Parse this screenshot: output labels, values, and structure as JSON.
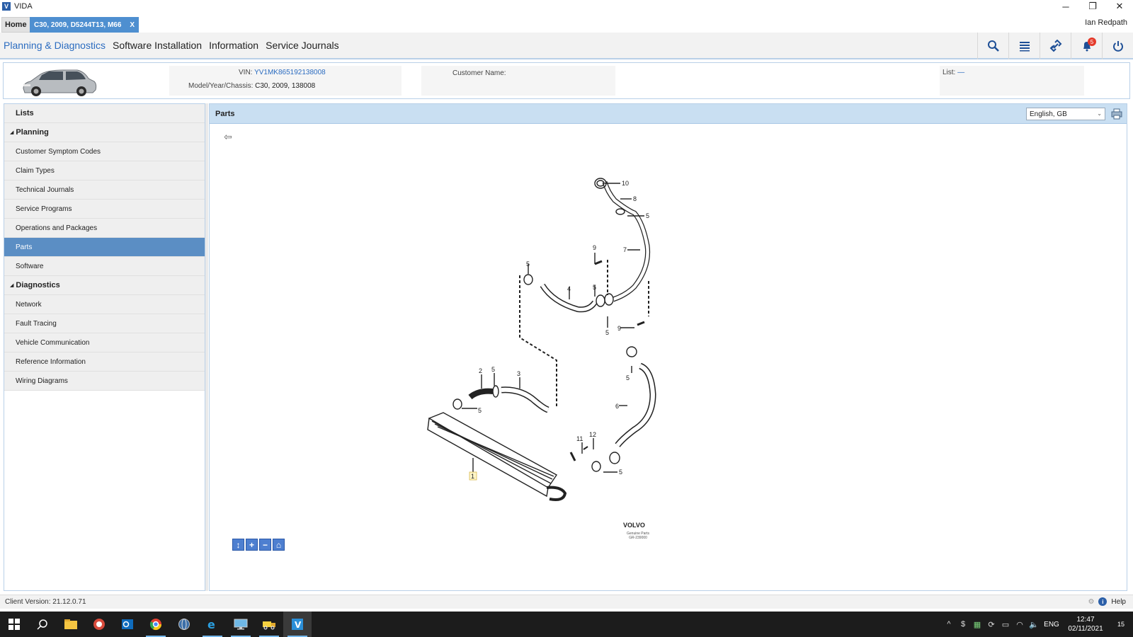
{
  "window": {
    "title": "VIDA",
    "logo": "V",
    "controls": {
      "minimize": "─",
      "restore": "❐",
      "close": "✕"
    }
  },
  "tabs": {
    "home": "Home",
    "vehicle": "C30, 2009, D5244T13, M66",
    "vehicle_close": "X"
  },
  "user": {
    "name": "Ian Redpath"
  },
  "main_nav": {
    "items": [
      "Planning & Diagnostics",
      "Software Installation",
      "Information",
      "Service Journals"
    ],
    "notifications": "5"
  },
  "vehicle": {
    "vin_label": "VIN:",
    "vin": "YV1MK865192138008",
    "model_label": "Model/Year/Chassis:",
    "model": "C30, 2009, 138008",
    "customer_label": "Customer Name:",
    "customer": "",
    "list_label": "List:",
    "list_value": "—"
  },
  "sidebar": {
    "lists": "Lists",
    "planning": {
      "label": "Planning",
      "items": [
        "Customer Symptom Codes",
        "Claim Types",
        "Technical Journals",
        "Service Programs",
        "Operations and Packages",
        "Parts",
        "Software"
      ]
    },
    "diagnostics": {
      "label": "Diagnostics",
      "items": [
        "Network",
        "Fault Tracing",
        "Vehicle Communication",
        "Reference Information",
        "Wiring Diagrams"
      ]
    },
    "active": "Parts"
  },
  "content": {
    "title": "Parts",
    "language": "English, GB",
    "diagram_labels": {
      "brand": "VOLVO",
      "caption": "Genuine Parts",
      "ref": "GR-239000",
      "callouts": [
        "10",
        "8",
        "5",
        "7",
        "9",
        "5",
        "4",
        "5",
        "5",
        "9",
        "5",
        "2",
        "5",
        "3",
        "5",
        "6",
        "11",
        "12",
        "1",
        "5"
      ]
    },
    "zoom_buttons": [
      "↕",
      "+",
      "−",
      "⌂"
    ]
  },
  "status": {
    "client_version": "Client Version:  21.12.0.71",
    "help": "Help"
  },
  "taskbar": {
    "lang": "ENG",
    "time": "12:47",
    "date": "02/11/2021",
    "notif_count": "15"
  }
}
